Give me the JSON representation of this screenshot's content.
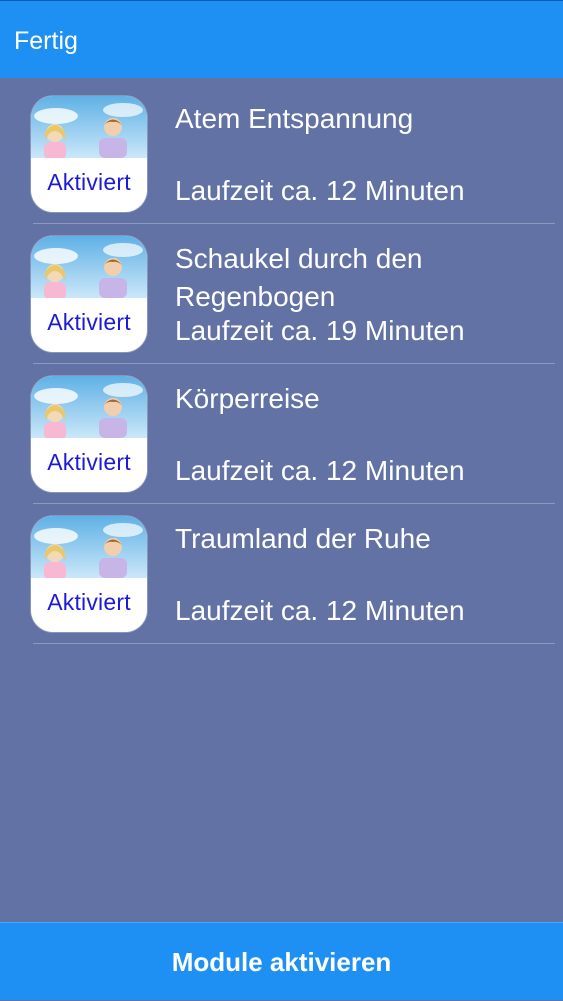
{
  "header": {
    "done_label": "Fertig"
  },
  "modules": [
    {
      "title": "Atem Entspannung",
      "runtime": "Laufzeit ca. 12 Minuten",
      "badge": "Aktiviert"
    },
    {
      "title": "Schaukel durch den Regenbogen",
      "runtime": "Laufzeit ca. 19 Minuten",
      "badge": "Aktiviert"
    },
    {
      "title": "Körperreise",
      "runtime": "Laufzeit ca. 12 Minuten",
      "badge": "Aktiviert"
    },
    {
      "title": "Traumland der Ruhe",
      "runtime": "Laufzeit ca. 12 Minuten",
      "badge": "Aktiviert"
    }
  ],
  "footer": {
    "activate_label": "Module aktivieren"
  },
  "colors": {
    "bar_blue": "#1e90f4",
    "background": "#6272a4",
    "badge_text": "#1b1ad8"
  },
  "icons": {
    "module_thumbnail": "kids-sky-thumbnail-icon"
  }
}
